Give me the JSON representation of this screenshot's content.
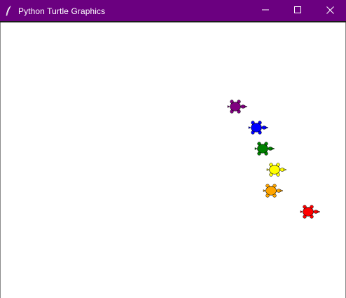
{
  "window": {
    "title": "Python Turtle Graphics",
    "titlebar_color": "#6b0080",
    "app_icon": "feather-icon"
  },
  "controls": {
    "minimize_icon": "minimize-icon",
    "maximize_icon": "maximize-icon",
    "close_icon": "close-icon"
  },
  "canvas": {
    "background": "#ffffff",
    "turtles": [
      {
        "color": "purple",
        "hex": "#800080",
        "heading": "east"
      },
      {
        "color": "blue",
        "hex": "#0000ff",
        "heading": "east"
      },
      {
        "color": "green",
        "hex": "#008000",
        "heading": "east"
      },
      {
        "color": "yellow",
        "hex": "#ffff00",
        "heading": "east"
      },
      {
        "color": "orange",
        "hex": "#ffa500",
        "heading": "east"
      },
      {
        "color": "red",
        "hex": "#ff0000",
        "heading": "east"
      }
    ]
  }
}
